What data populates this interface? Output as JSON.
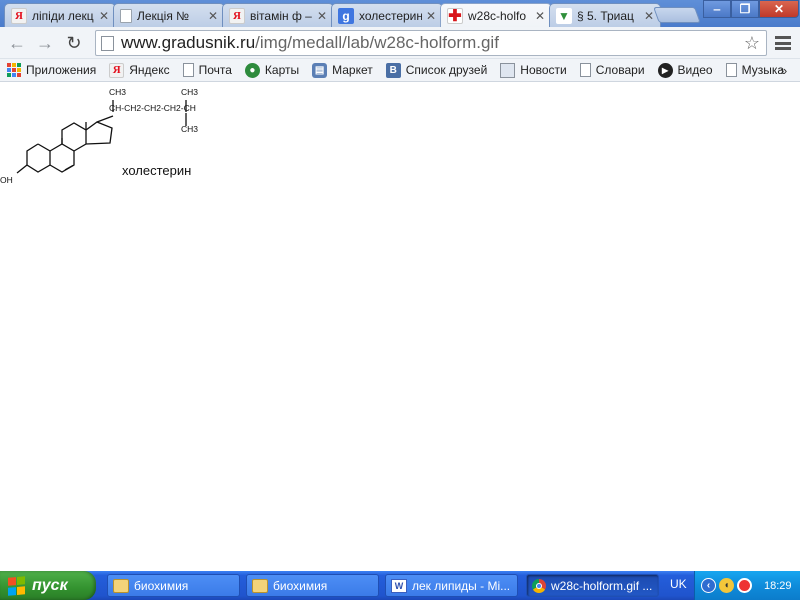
{
  "tabs": [
    {
      "label": "ліпіди лекц",
      "icon": "yandex-icon",
      "active": false
    },
    {
      "label": "Лекція №",
      "icon": "page-icon",
      "active": false
    },
    {
      "label": "вітамін ф –",
      "icon": "yandex-icon",
      "active": false
    },
    {
      "label": "холестерин",
      "icon": "google-icon",
      "active": false
    },
    {
      "label": "w28c-holfo",
      "icon": "red-cross-icon",
      "active": true
    },
    {
      "label": "§ 5. Триац",
      "icon": "v-icon",
      "active": false
    }
  ],
  "tab_favicon_glyphs": {
    "yandex": "Я",
    "google": "g",
    "cross": "✚",
    "v": "▼"
  },
  "window": {
    "minimize": "‒",
    "restore": "❐",
    "close": "✕"
  },
  "toolbar": {
    "url_host": "www.gradusnik.ru",
    "url_path": "/img/medall/lab/w28c-holform.gif",
    "back": "←",
    "forward": "→",
    "reload": "↻",
    "star": "☆"
  },
  "bookmarks": [
    {
      "label": "Приложения",
      "icon": "apps-icon"
    },
    {
      "label": "Яндекс",
      "icon": "yandex-icon"
    },
    {
      "label": "Почта",
      "icon": "page-icon"
    },
    {
      "label": "Карты",
      "icon": "maps-icon"
    },
    {
      "label": "Маркет",
      "icon": "market-icon"
    },
    {
      "label": "Список друзей",
      "icon": "vk-icon"
    },
    {
      "label": "Новости",
      "icon": "news-icon"
    },
    {
      "label": "Словари",
      "icon": "page-icon"
    },
    {
      "label": "Видео",
      "icon": "video-icon"
    },
    {
      "label": "Музыка",
      "icon": "page-icon"
    }
  ],
  "bookmarks_more": "»",
  "image": {
    "caption": "холестерин",
    "label_oh": "OH",
    "label_ch3_top": "CH3",
    "label_chain": "CH-CH2-CH2-CH2-CH",
    "label_ch3_branch1": "CH3",
    "label_ch3_branch2": "CH3"
  },
  "taskbar": {
    "start_label": "пуск",
    "tasks": [
      {
        "label": "биохимия",
        "icon": "folder-icon",
        "active": false
      },
      {
        "label": "биохимия",
        "icon": "folder-icon",
        "active": false
      },
      {
        "label": "лек липиды - Mi...",
        "icon": "word-icon",
        "active": false
      },
      {
        "label": "w28c-holform.gif ...",
        "icon": "chrome-icon",
        "active": true
      }
    ],
    "language": "UK",
    "clock": "18:29"
  },
  "colors": {
    "taskbar": "#245edb",
    "start": "#33922f",
    "tabstrip": "#5f8fd8",
    "toolbar": "#f1f4f8",
    "accent_red": "#d8161b"
  }
}
